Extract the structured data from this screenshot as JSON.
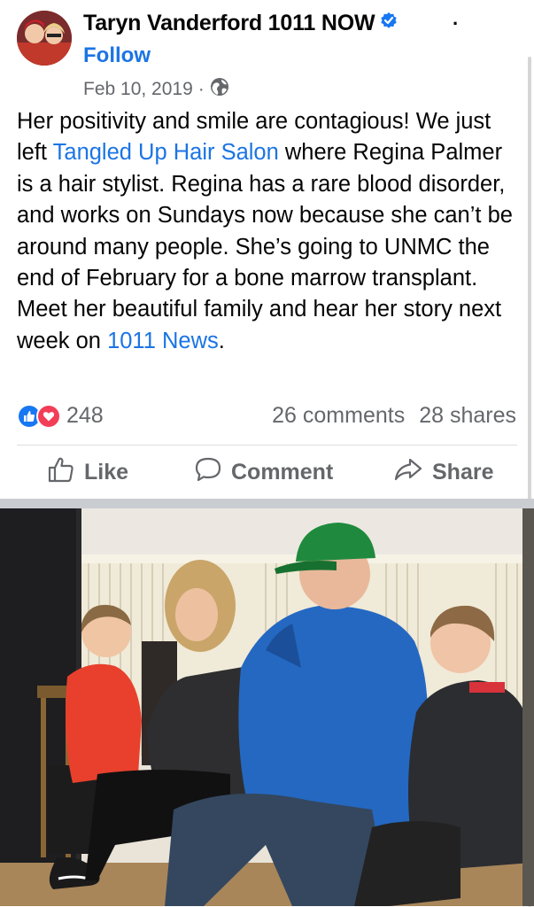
{
  "post": {
    "author": "Taryn Vanderford 1011 NOW",
    "more_glyph": "·",
    "follow_label": "Follow",
    "date": "Feb 10, 2019",
    "date_separator": "·",
    "audience_icon": "globe-icon",
    "text_parts": [
      {
        "type": "text",
        "value": "Her positivity and smile are contagious! We just left "
      },
      {
        "type": "link",
        "value": "Tangled Up Hair Salon"
      },
      {
        "type": "text",
        "value": " where Regina Palmer is a hair stylist. Regina has a rare blood disorder, and works on Sundays now because she can’t be around many people. She’s going to UNMC the end of February for a bone marrow transplant. Meet her beautiful family and hear her story next week on "
      },
      {
        "type": "link",
        "value": "1011 News"
      },
      {
        "type": "text",
        "value": "."
      }
    ]
  },
  "engagement": {
    "reaction_count": "248",
    "comments": "26 comments",
    "shares": "28 shares"
  },
  "actions": {
    "like": "Like",
    "comment": "Comment",
    "share": "Share"
  },
  "colors": {
    "link": "#1b74e4",
    "secondary_text": "#65676b",
    "like_blue": "#1877f2",
    "love_red": "#f33e58"
  }
}
